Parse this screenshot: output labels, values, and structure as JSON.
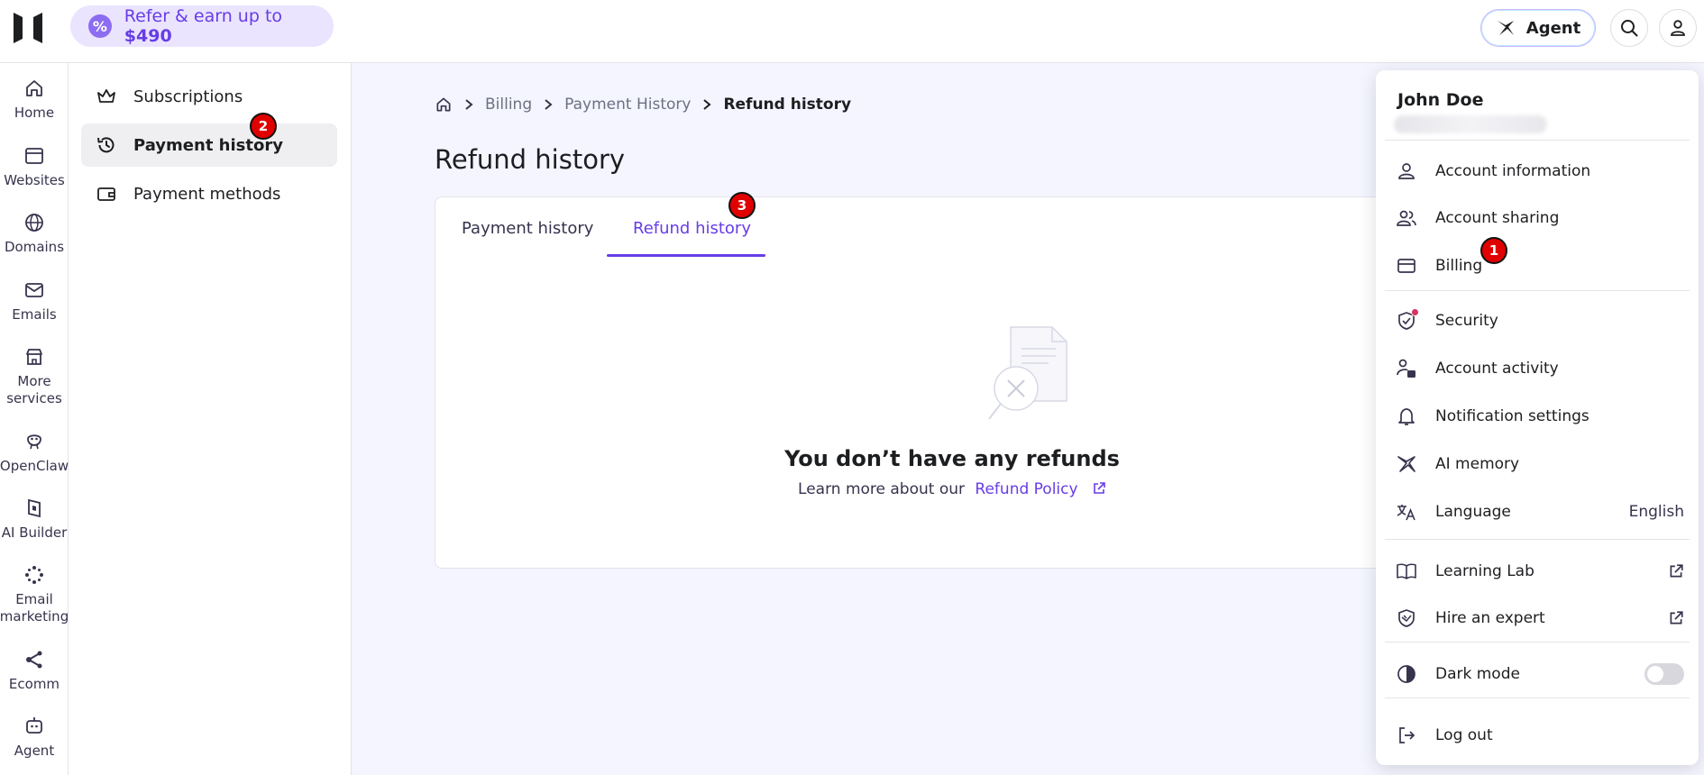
{
  "topbar": {
    "refer_text": "Refer & earn up to ",
    "refer_amount": "$490",
    "agent_label": "Agent"
  },
  "rail": [
    {
      "label": "Home",
      "icon": "home-icon"
    },
    {
      "label": "Websites",
      "icon": "browser-window-icon"
    },
    {
      "label": "Domains",
      "icon": "globe-icon"
    },
    {
      "label": "Emails",
      "icon": "mail-icon"
    },
    {
      "label": "More services",
      "icon": "store-icon"
    },
    {
      "label": "OpenClaw",
      "icon": "openclaw-icon"
    },
    {
      "label": "AI Builder",
      "icon": "ai-builder-icon"
    },
    {
      "label": "Email marketing",
      "icon": "email-marketing-icon"
    },
    {
      "label": "Ecomm",
      "icon": "ecommerce-icon"
    },
    {
      "label": "Agent",
      "icon": "agent-bot-icon"
    }
  ],
  "subnav": {
    "items": [
      {
        "label": "Subscriptions",
        "icon": "crown-icon"
      },
      {
        "label": "Payment history",
        "icon": "history-icon",
        "active": true
      },
      {
        "label": "Payment methods",
        "icon": "wallet-icon"
      }
    ]
  },
  "breadcrumb": {
    "items": [
      "Billing",
      "Payment History"
    ],
    "current": "Refund history"
  },
  "page": {
    "title": "Refund history",
    "tabs": [
      {
        "label": "Payment history"
      },
      {
        "label": "Refund history",
        "active": true
      }
    ],
    "empty_title": "You don’t have any refunds",
    "empty_text": "Learn more about our",
    "empty_link": "Refund Policy"
  },
  "menu": {
    "user_name": "John Doe",
    "items": [
      {
        "label": "Account information",
        "icon": "person-icon"
      },
      {
        "label": "Account sharing",
        "icon": "people-icon"
      },
      {
        "label": "Billing",
        "icon": "credit-card-icon"
      },
      {
        "label": "Security",
        "icon": "shield-check-icon"
      },
      {
        "label": "Account activity",
        "icon": "account-activity-icon"
      },
      {
        "label": "Notification settings",
        "icon": "bell-icon"
      },
      {
        "label": "AI memory",
        "icon": "ai-sparkle-icon"
      },
      {
        "label": "Language",
        "icon": "translate-icon",
        "value": "English"
      },
      {
        "label": "Learning Lab",
        "icon": "book-icon"
      },
      {
        "label": "Hire an expert",
        "icon": "expert-shield-icon"
      },
      {
        "label": "Dark mode",
        "icon": "contrast-icon",
        "toggle": false
      },
      {
        "label": "Log out",
        "icon": "logout-icon"
      }
    ]
  },
  "markers": [
    "1",
    "2",
    "3"
  ],
  "colors": {
    "accent": "#673de6",
    "accent_light": "#ebe4ff",
    "marker_red": "#e00000",
    "notification_dot": "#d63163"
  }
}
